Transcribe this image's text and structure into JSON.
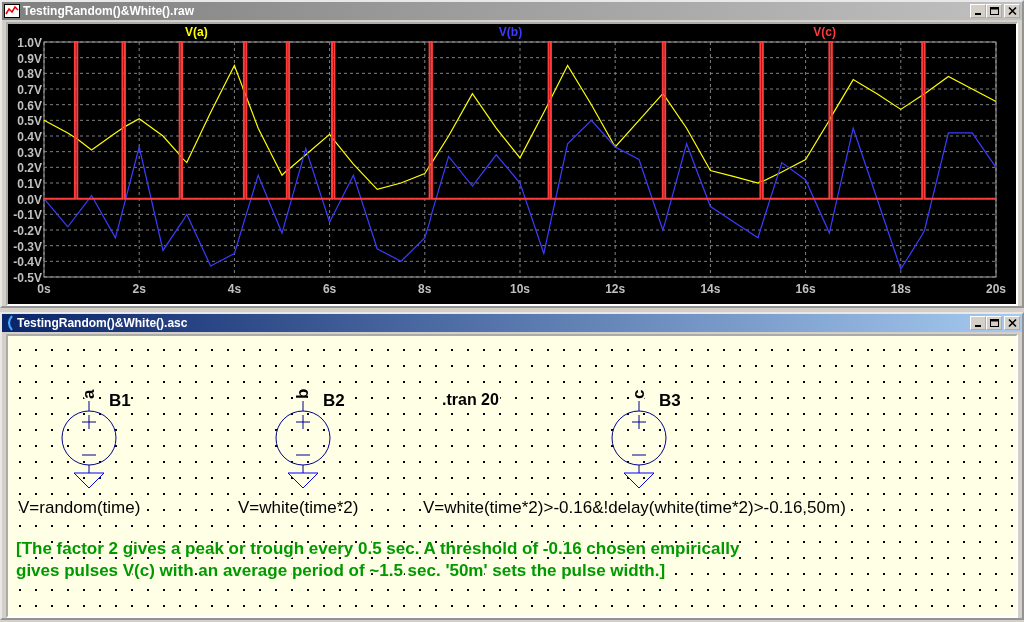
{
  "plot_window": {
    "title": "TestingRandom()&White().raw",
    "chart_data": {
      "type": "line",
      "x": [
        0,
        0.5,
        0.65,
        0.65,
        0.7,
        0.7,
        1,
        1.5,
        1.65,
        1.65,
        1.7,
        1.7,
        2,
        2.5,
        2.85,
        2.85,
        2.9,
        2.9,
        3,
        3.5,
        4,
        4.2,
        4.2,
        4.25,
        4.25,
        4.5,
        5,
        5.1,
        5.1,
        5.15,
        5.15,
        5.5,
        6,
        6.05,
        6.05,
        6.1,
        6.1,
        6.5,
        7,
        7.5,
        8,
        8.1,
        8.1,
        8.15,
        8.15,
        8.5,
        9,
        9.5,
        10,
        10.5,
        10.6,
        10.6,
        10.65,
        10.65,
        11,
        11.5,
        12,
        12.5,
        13,
        13,
        13.05,
        13.05,
        13.5,
        14,
        14.5,
        15,
        15.05,
        15.05,
        15.1,
        15.1,
        15.5,
        16,
        16.5,
        16.5,
        16.55,
        16.55,
        17,
        17.5,
        18,
        18.45,
        18.45,
        18.5,
        18.5,
        19,
        19.5,
        20
      ],
      "series": [
        {
          "name": "V(a)",
          "color": "#ffff00",
          "values": [
            0.5,
            0.42,
            0.39,
            0.39,
            0.38,
            0.38,
            0.31,
            0.42,
            0.45,
            0.45,
            0.46,
            0.46,
            0.51,
            0.4,
            0.28,
            0.28,
            0.26,
            0.26,
            0.23,
            0.55,
            0.85,
            0.69,
            0.69,
            0.65,
            0.65,
            0.45,
            0.15,
            0.18,
            0.18,
            0.19,
            0.19,
            0.28,
            0.41,
            0.39,
            0.39,
            0.37,
            0.37,
            0.22,
            0.06,
            0.1,
            0.16,
            0.21,
            0.21,
            0.23,
            0.23,
            0.4,
            0.67,
            0.45,
            0.26,
            0.55,
            0.61,
            0.61,
            0.64,
            0.64,
            0.85,
            0.6,
            0.33,
            0.5,
            0.67,
            0.67,
            0.65,
            0.65,
            0.45,
            0.18,
            0.14,
            0.1,
            0.11,
            0.11,
            0.11,
            0.11,
            0.17,
            0.25,
            0.5,
            0.5,
            0.53,
            0.53,
            0.76,
            0.67,
            0.57,
            0.66,
            0.66,
            0.67,
            0.67,
            0.78,
            0.7,
            0.62
          ]
        },
        {
          "name": "V(b)",
          "color": "#3c3cff",
          "values": [
            0,
            -0.18,
            -0.12,
            -0.12,
            -0.1,
            -0.1,
            0.02,
            -0.25,
            -0.08,
            -0.08,
            -0.02,
            -0.02,
            0.33,
            -0.33,
            -0.17,
            -0.17,
            -0.15,
            -0.15,
            -0.1,
            -0.43,
            -0.35,
            -0.15,
            -0.15,
            -0.1,
            -0.1,
            0.15,
            -0.22,
            -0.11,
            -0.11,
            -0.06,
            -0.06,
            0.32,
            -0.15,
            -0.12,
            -0.12,
            -0.09,
            -0.09,
            0.15,
            -0.32,
            -0.4,
            -0.25,
            -0.15,
            -0.15,
            -0.09,
            -0.09,
            0.27,
            0.08,
            0.28,
            0.1,
            -0.35,
            -0.21,
            -0.21,
            -0.14,
            -0.14,
            0.35,
            0.5,
            0.33,
            0.25,
            -0.2,
            -0.2,
            -0.15,
            -0.15,
            0.35,
            -0.05,
            -0.15,
            -0.25,
            -0.2,
            -0.2,
            -0.15,
            -0.15,
            0.23,
            0.12,
            -0.22,
            -0.22,
            -0.15,
            -0.15,
            0.45,
            0,
            -0.45,
            -0.23,
            -0.23,
            -0.2,
            -0.2,
            0.42,
            0.42,
            0.2
          ]
        },
        {
          "name": "V(c)",
          "color": "#ff3c3c",
          "values": [
            0,
            0,
            0,
            1,
            1,
            0,
            0,
            0,
            0,
            1,
            1,
            0,
            0,
            0,
            0,
            1,
            1,
            0,
            0,
            0,
            0,
            0,
            1,
            1,
            0,
            0,
            0,
            0,
            1,
            1,
            0,
            0,
            0,
            0,
            1,
            1,
            0,
            0,
            0,
            0,
            0,
            0,
            1,
            1,
            0,
            0,
            0,
            0,
            0,
            0,
            0,
            1,
            1,
            0,
            0,
            0,
            0,
            0,
            0,
            1,
            1,
            0,
            0,
            0,
            0,
            0,
            0,
            1,
            1,
            0,
            0,
            0,
            0,
            1,
            1,
            0,
            0,
            0,
            0,
            0,
            1,
            1,
            0,
            0,
            0,
            0
          ]
        }
      ],
      "grid": true,
      "xlim": [
        0,
        20
      ],
      "ylim": [
        -0.5,
        1
      ],
      "xticks": [
        {
          "value": 0,
          "label": "0s"
        },
        {
          "value": 2,
          "label": "2s"
        },
        {
          "value": 4,
          "label": "4s"
        },
        {
          "value": 6,
          "label": "6s"
        },
        {
          "value": 8,
          "label": "8s"
        },
        {
          "value": 10,
          "label": "10s"
        },
        {
          "value": 12,
          "label": "12s"
        },
        {
          "value": 14,
          "label": "14s"
        },
        {
          "value": 16,
          "label": "16s"
        },
        {
          "value": 18,
          "label": "18s"
        },
        {
          "value": 20,
          "label": "20s"
        }
      ],
      "yticks": [
        {
          "value": 1,
          "label": "1.0V"
        },
        {
          "value": 0.9,
          "label": "0.9V"
        },
        {
          "value": 0.8,
          "label": "0.8V"
        },
        {
          "value": 0.7,
          "label": "0.7V"
        },
        {
          "value": 0.6,
          "label": "0.6V"
        },
        {
          "value": 0.5,
          "label": "0.5V"
        },
        {
          "value": 0.4,
          "label": "0.4V"
        },
        {
          "value": 0.3,
          "label": "0.3V"
        },
        {
          "value": 0.2,
          "label": "0.2V"
        },
        {
          "value": 0.1,
          "label": "0.1V"
        },
        {
          "value": 0,
          "label": "0.0V"
        },
        {
          "value": -0.1,
          "label": "-0.1V"
        },
        {
          "value": -0.2,
          "label": "-0.2V"
        },
        {
          "value": -0.3,
          "label": "-0.3V"
        },
        {
          "value": -0.4,
          "label": "-0.4V"
        },
        {
          "value": -0.5,
          "label": "-0.5V"
        }
      ]
    }
  },
  "schematic_window": {
    "title": "TestingRandom()&White().asc",
    "components": [
      {
        "name": "B1",
        "node": "a",
        "expression": "V=random(time)"
      },
      {
        "name": "B2",
        "node": "b",
        "expression": "V=white(time*2)"
      },
      {
        "name": "B3",
        "node": "c",
        "expression": "V=white(time*2)>-0.16&!delay(white(time*2)>-0.16,50m)"
      }
    ],
    "directive": ".tran 20",
    "comment_lines": [
      "[The factor 2 gives a peak or trough every 0.5 sec. A threshold of -0.16 chosen empirically",
      "gives pulses V(c) with an average period of ~1.5 sec.  '50m' sets the pulse width.]"
    ]
  }
}
